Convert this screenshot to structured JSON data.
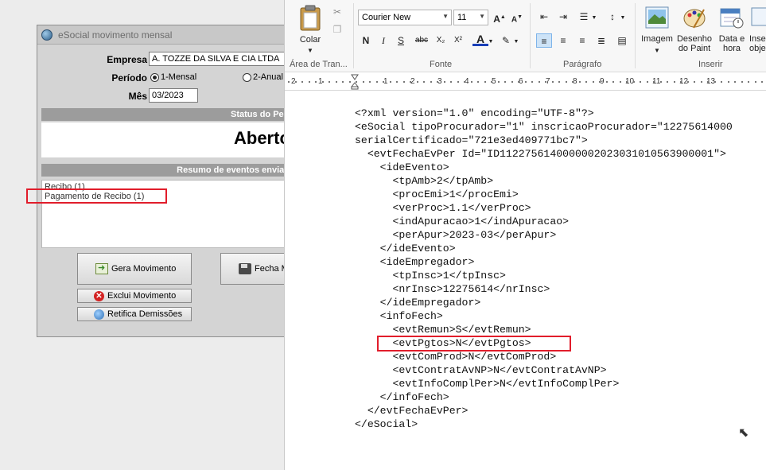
{
  "esocial": {
    "title": "eSocial movimento mensal",
    "empresa_label": "Empresa",
    "empresa_value": "A. TOZZE DA SILVA E CIA LTDA",
    "periodo_label": "Período",
    "periodo_options": [
      "1-Mensal",
      "2-Anual"
    ],
    "periodo_selected": "1-Mensal",
    "mes_label": "Mês",
    "mes_value": "03/2023",
    "status_header": "Status do Peri",
    "status_value": "Abertc",
    "resumo_header": "Resumo de eventos enviad",
    "events": [
      "Recibo (1)",
      "Pagamento de Recibo (1)"
    ],
    "buttons": {
      "gera": "Gera Movimento",
      "fecha": "Fecha M",
      "exclui": "Exclui Movimento",
      "retifica": "Retifica Demissões"
    }
  },
  "wordpad": {
    "ribbon": {
      "paste_label": "Colar",
      "clipboard_label": "Área de Tran...",
      "font_name": "Courier New",
      "font_size": "11",
      "font_group_label": "Fonte",
      "paragraph_group_label": "Parágrafo",
      "insert_group_label": "Inserir",
      "bold": "N",
      "italic": "I",
      "underline": "S",
      "strike": "abc",
      "subscript": "X₂",
      "superscript": "X²",
      "image_label": "Imagem",
      "paint_label": "Desenho do Paint",
      "datetime_label": "Data e hora",
      "insert_object_label": "Inse obje"
    },
    "ruler_numbers": [
      "2",
      "1",
      "1",
      "2",
      "3",
      "4",
      "5",
      "6",
      "7",
      "8",
      "9",
      "10",
      "11",
      "12",
      "13"
    ],
    "document_lines": [
      "<?xml version=\"1.0\" encoding=\"UTF-8\"?>",
      "<eSocial tipoProcurador=\"1\" inscricaoProcurador=\"12275614000",
      "serialCertificado=\"721e3ed409771bc7\">",
      "  <evtFechaEvPer Id=\"ID1122756140000002023031010563900001\">",
      "    <ideEvento>",
      "      <tpAmb>2</tpAmb>",
      "      <procEmi>1</procEmi>",
      "      <verProc>1.1</verProc>",
      "      <indApuracao>1</indApuracao>",
      "      <perApur>2023-03</perApur>",
      "    </ideEvento>",
      "    <ideEmpregador>",
      "      <tpInsc>1</tpInsc>",
      "      <nrInsc>12275614</nrInsc>",
      "    </ideEmpregador>",
      "    <infoFech>",
      "      <evtRemun>S</evtRemun>",
      "      <evtPgtos>N</evtPgtos>",
      "      <evtComProd>N</evtComProd>",
      "      <evtContratAvNP>N</evtContratAvNP>",
      "      <evtInfoComplPer>N</evtInfoComplPer>",
      "    </infoFech>",
      "  </evtFechaEvPer>",
      "</eSocial>"
    ]
  },
  "colors": {
    "highlight_box": "#e11d2b",
    "section_bar": "#9c9c9c",
    "ribbon_bg": "#f7f7f7"
  }
}
